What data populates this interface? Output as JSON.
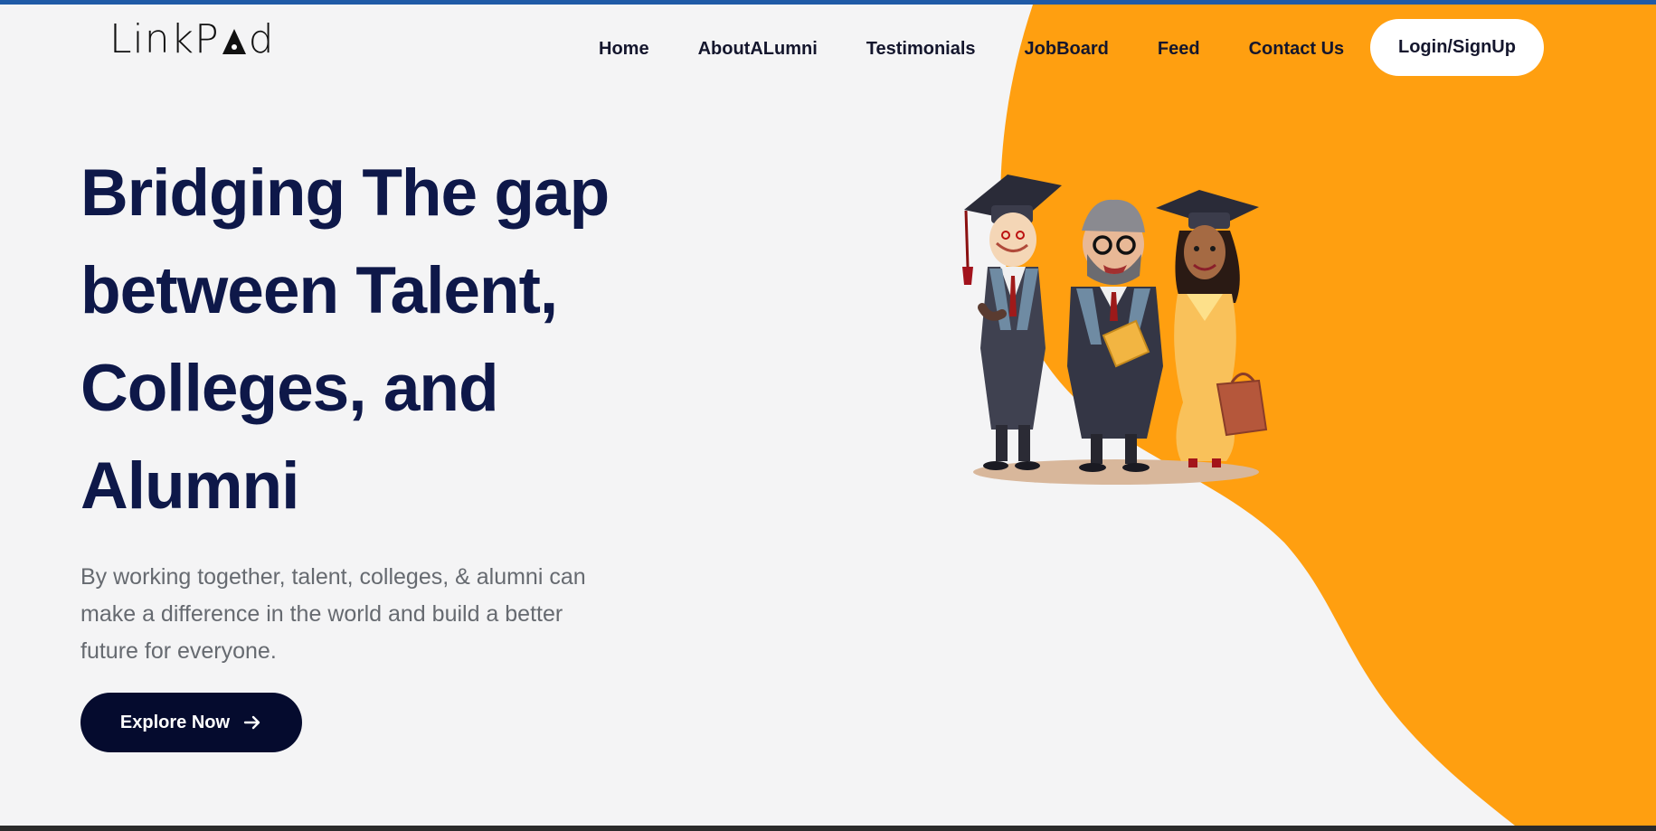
{
  "brand": {
    "logo_text_left": "LinkP",
    "logo_text_right": "d"
  },
  "nav": {
    "items": [
      "Home",
      "AboutALumni",
      "Testimonials",
      "JobBoard",
      "Feed",
      "Contact Us"
    ],
    "login_label": "Login/SignUp"
  },
  "hero": {
    "title": "Bridging The gap between Talent, Colleges, and Alumni",
    "subtitle": "By working together, talent, colleges, & alumni can make a difference in the world and build a better future for everyone.",
    "cta_label": "Explore Now",
    "cta_icon": "arrow-right-icon"
  },
  "colors": {
    "accent_orange": "#ff9f10",
    "title_navy": "#0e1849",
    "button_dark": "#050b2e",
    "top_bar_blue": "#1f5aa6",
    "background": "#f4f4f5"
  },
  "illustration": {
    "subject": "three graduates in caps and gowns"
  }
}
